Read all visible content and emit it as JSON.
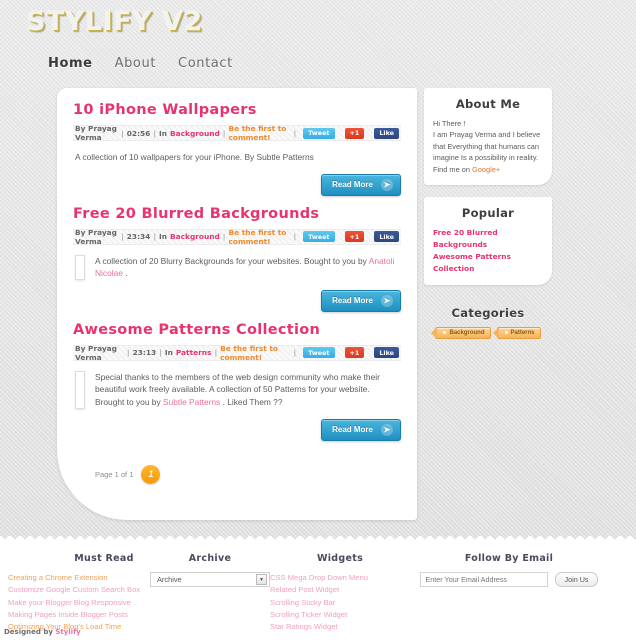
{
  "site": {
    "logo": "STYLIFY V2",
    "nav": [
      {
        "label": "Home",
        "active": true
      },
      {
        "label": "About",
        "active": false
      },
      {
        "label": "Contact",
        "active": false
      }
    ]
  },
  "posts": [
    {
      "title": "10 iPhone Wallpapers",
      "author": "By Prayag Verma",
      "time": "02:56",
      "in_label": "In",
      "category": "Background",
      "comment": "Be the first to comment!",
      "tweet": "Tweet",
      "plusone": "+1",
      "like": "Like",
      "body_before": "A collection of 10 wallpapers for your iPhone. By Subtle Patterns",
      "link_text": "",
      "body_after": "",
      "thumb": "none",
      "readmore": "Read More"
    },
    {
      "title": "Free 20 Blurred Backgrounds",
      "author": "By Prayag Verma",
      "time": "23:34",
      "in_label": "In",
      "category": "Background",
      "comment": "Be the first to comment!",
      "tweet": "Tweet",
      "plusone": "+1",
      "like": "Like",
      "body_before": "A collection of 20 Blurry Backgrounds for your websites. Bought to you by ",
      "link_text": "Anatoli Nicolae",
      "body_after": " .",
      "thumb": "blurred-landscape",
      "readmore": "Read More"
    },
    {
      "title": "Awesome Patterns Collection",
      "author": "By Prayag Verma",
      "time": "23:13",
      "in_label": "In",
      "category": "Patterns",
      "comment": "Be the first to comment!",
      "tweet": "Tweet",
      "plusone": "+1",
      "like": "Like",
      "body_before": "Special thanks to the members of the web design community who make their beautiful work freely available. A collection of 50 Patterns for your website. Brought to you by ",
      "link_text": "Subtle Patterns",
      "body_after": " . Liked Them ??",
      "thumb": "pattern-swatch",
      "readmore": "Read More"
    }
  ],
  "pager": {
    "label": "Page 1 of 1",
    "current": "1"
  },
  "sidebar": {
    "about": {
      "title": "About Me",
      "greeting": "Hi There !",
      "text": "I am Prayag Verma and I believe that Everything that humans can imagine Is a possibility in reality. Find me on ",
      "link": "Google+"
    },
    "popular": {
      "title": "Popular",
      "items": [
        "Free 20 Blurred Backgrounds",
        "Awesome Patterns Collection"
      ]
    },
    "categories": {
      "title": "Categories",
      "tags": [
        "Background",
        "Patterns"
      ]
    }
  },
  "footer": {
    "must_read": {
      "title": "Must Read",
      "links": [
        "Creating a Chrome Extension",
        "Customize Google Custom Search Box",
        "Make your Blogger Blog Responsive",
        "Making Pages Inside Blogger Posts",
        "Optimizing Your Blog's Load Time"
      ]
    },
    "archive": {
      "title": "Archive",
      "selected": "Archive"
    },
    "widgets": {
      "title": "Widgets",
      "links": [
        "CSS Mega Drop Down Menu",
        "Related Post Widget",
        "Scrolling Sticky Bar",
        "Scrolling Ticker Widget",
        "Star Ratings Widget"
      ]
    },
    "follow": {
      "title": "Follow By Email",
      "placeholder": "Enter Your Email Address",
      "button": "Join Us"
    },
    "credit_prefix": "Designed by ",
    "credit_link": "Stylify"
  },
  "colors": {
    "accent_pink": "#e8346c",
    "accent_orange": "#f79b06",
    "accent_blue": "#1f8fc0"
  }
}
